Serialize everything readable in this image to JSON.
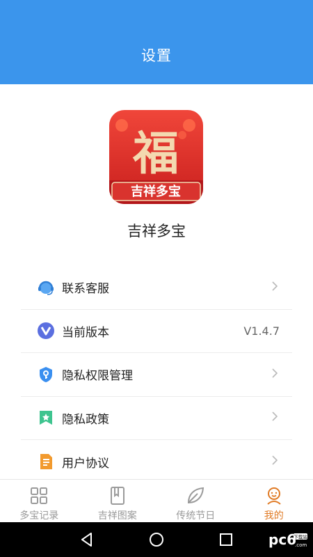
{
  "header": {
    "title": "设置"
  },
  "app": {
    "logo_text": "吉祥多宝",
    "logo_glyph": "福",
    "name": "吉祥多宝"
  },
  "menu": [
    {
      "label": "联系客服",
      "icon": "customer-service-icon",
      "right": "chevron"
    },
    {
      "label": "当前版本",
      "icon": "version-icon",
      "value": "V1.4.7"
    },
    {
      "label": "隐私权限管理",
      "icon": "shield-key-icon",
      "right": "chevron"
    },
    {
      "label": "隐私政策",
      "icon": "bookmark-star-icon",
      "right": "chevron"
    },
    {
      "label": "用户协议",
      "icon": "document-icon",
      "right": "chevron"
    }
  ],
  "tabs": [
    {
      "label": "多宝记录",
      "icon": "grid-icon",
      "active": false
    },
    {
      "label": "吉祥图案",
      "icon": "book-icon",
      "active": false
    },
    {
      "label": "传统节日",
      "icon": "leaf-icon",
      "active": false
    },
    {
      "label": "我的",
      "icon": "smiley-user-icon",
      "active": true
    }
  ],
  "colors": {
    "header": "#3b95ec",
    "active_tab": "#e07a24",
    "inactive_tab": "#9a9a9a",
    "logo_red": "#e0322b"
  },
  "watermark": {
    "text": "pc6",
    "sub": "下载站",
    "domain": ".com"
  }
}
